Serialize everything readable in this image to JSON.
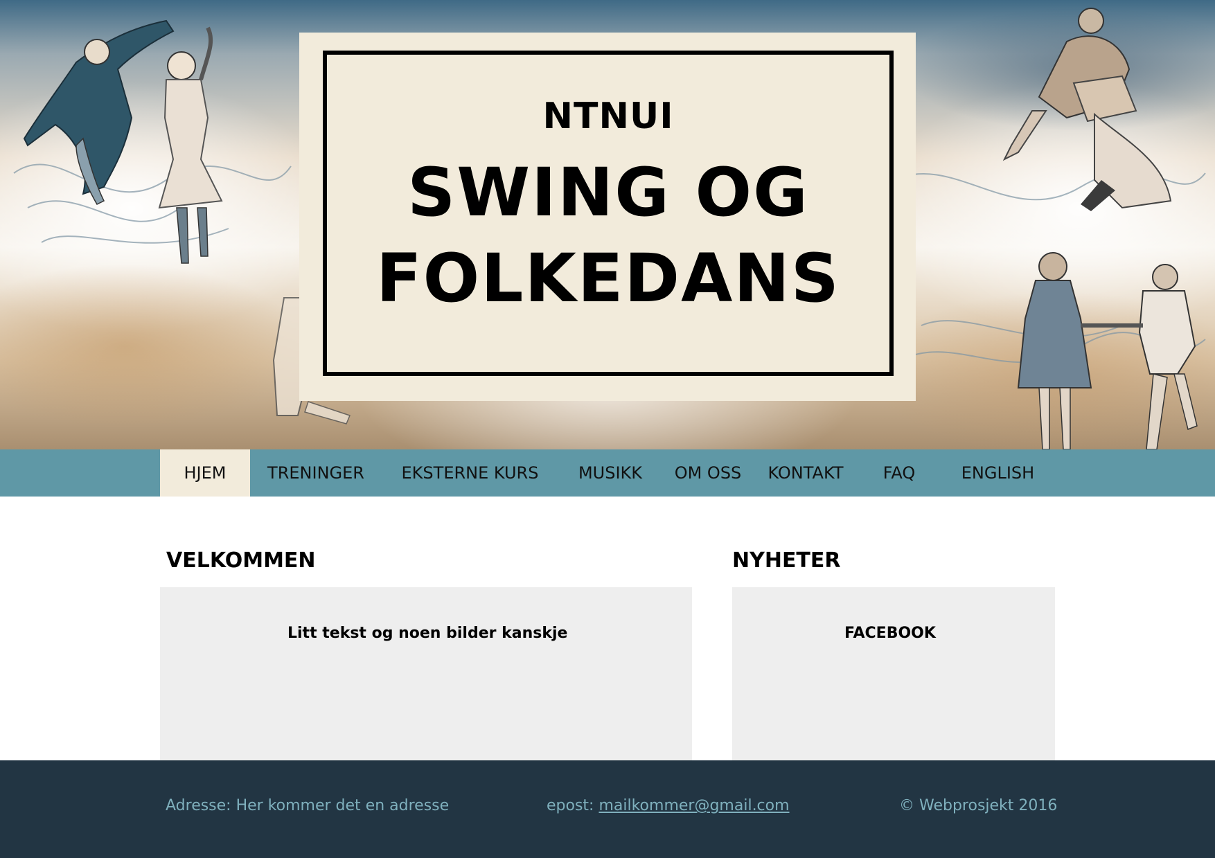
{
  "header": {
    "org": "NTNUI",
    "title_line1": "SWING OG",
    "title_line2": "FOLKEDANS"
  },
  "nav": {
    "items": [
      {
        "label": "HJEM",
        "active": true
      },
      {
        "label": "TRENINGER",
        "active": false
      },
      {
        "label": "EKSTERNE KURS",
        "active": false
      },
      {
        "label": "MUSIKK",
        "active": false
      },
      {
        "label": "OM OSS",
        "active": false
      },
      {
        "label": "KONTAKT",
        "active": false
      },
      {
        "label": "FAQ",
        "active": false
      },
      {
        "label": "ENGLISH",
        "active": false
      }
    ]
  },
  "main": {
    "welcome_title": "VELKOMMEN",
    "welcome_text": "Litt tekst og noen bilder kanskje",
    "news_title": "NYHETER",
    "news_text": "FACEBOOK"
  },
  "footer": {
    "address": "Adresse: Her kommer det en adresse",
    "email_prefix": "epost:",
    "email": "mailkommer@gmail.com",
    "copyright": "© Webprosjekt 2016"
  },
  "colors": {
    "nav_bg": "#5f98a6",
    "active_bg": "#f2ebdb",
    "footer_bg": "#223543",
    "footer_text": "#7fb0bd",
    "panel_bg": "#eeeeee"
  }
}
